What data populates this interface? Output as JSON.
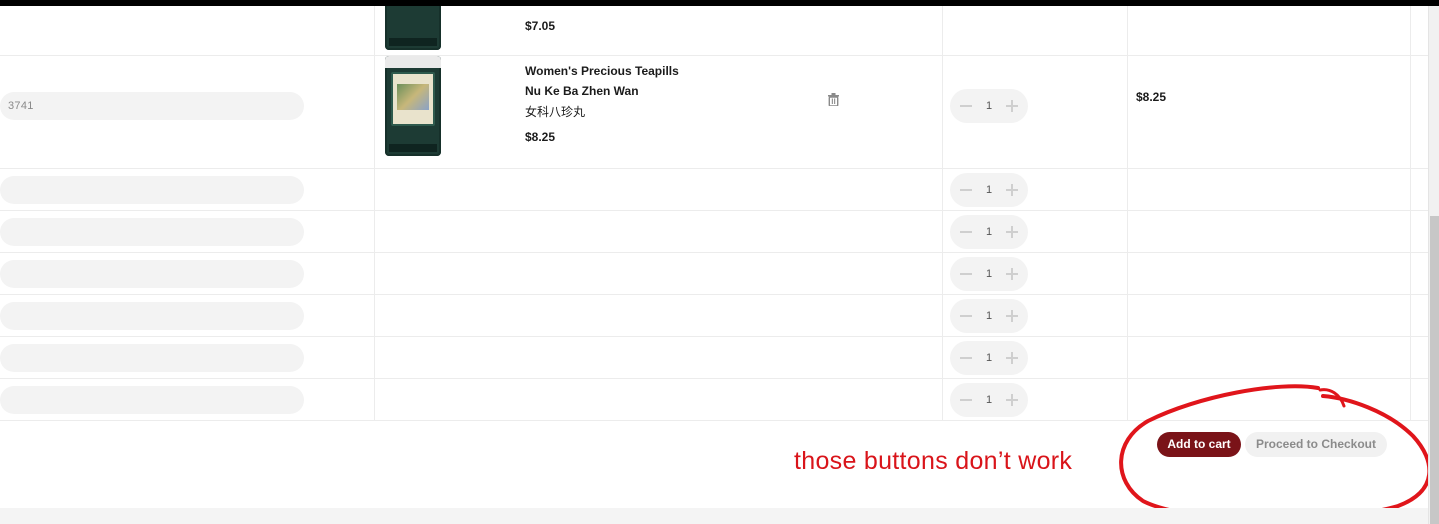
{
  "cart": {
    "top_item": {
      "price": "$7.05"
    },
    "item": {
      "sku": "3741",
      "name": "Women's Precious Teapills",
      "pinyin": "Nu Ke Ba Zhen Wan",
      "chinese": "女科八珍丸",
      "price": "$8.25",
      "quantity": "1",
      "subtotal": "$8.25"
    },
    "empty_rows": [
      {
        "quantity": "1"
      },
      {
        "quantity": "1"
      },
      {
        "quantity": "1"
      },
      {
        "quantity": "1"
      },
      {
        "quantity": "1"
      },
      {
        "quantity": "1"
      }
    ]
  },
  "actions": {
    "add_to_cart_label": "Add to cart",
    "checkout_label": "Proceed to Checkout"
  },
  "annotation": {
    "text": "those buttons don’t work",
    "color": "#d9141a"
  },
  "colors": {
    "primary_button": "#7a1318",
    "secondary_button": "#f1f1f1"
  }
}
